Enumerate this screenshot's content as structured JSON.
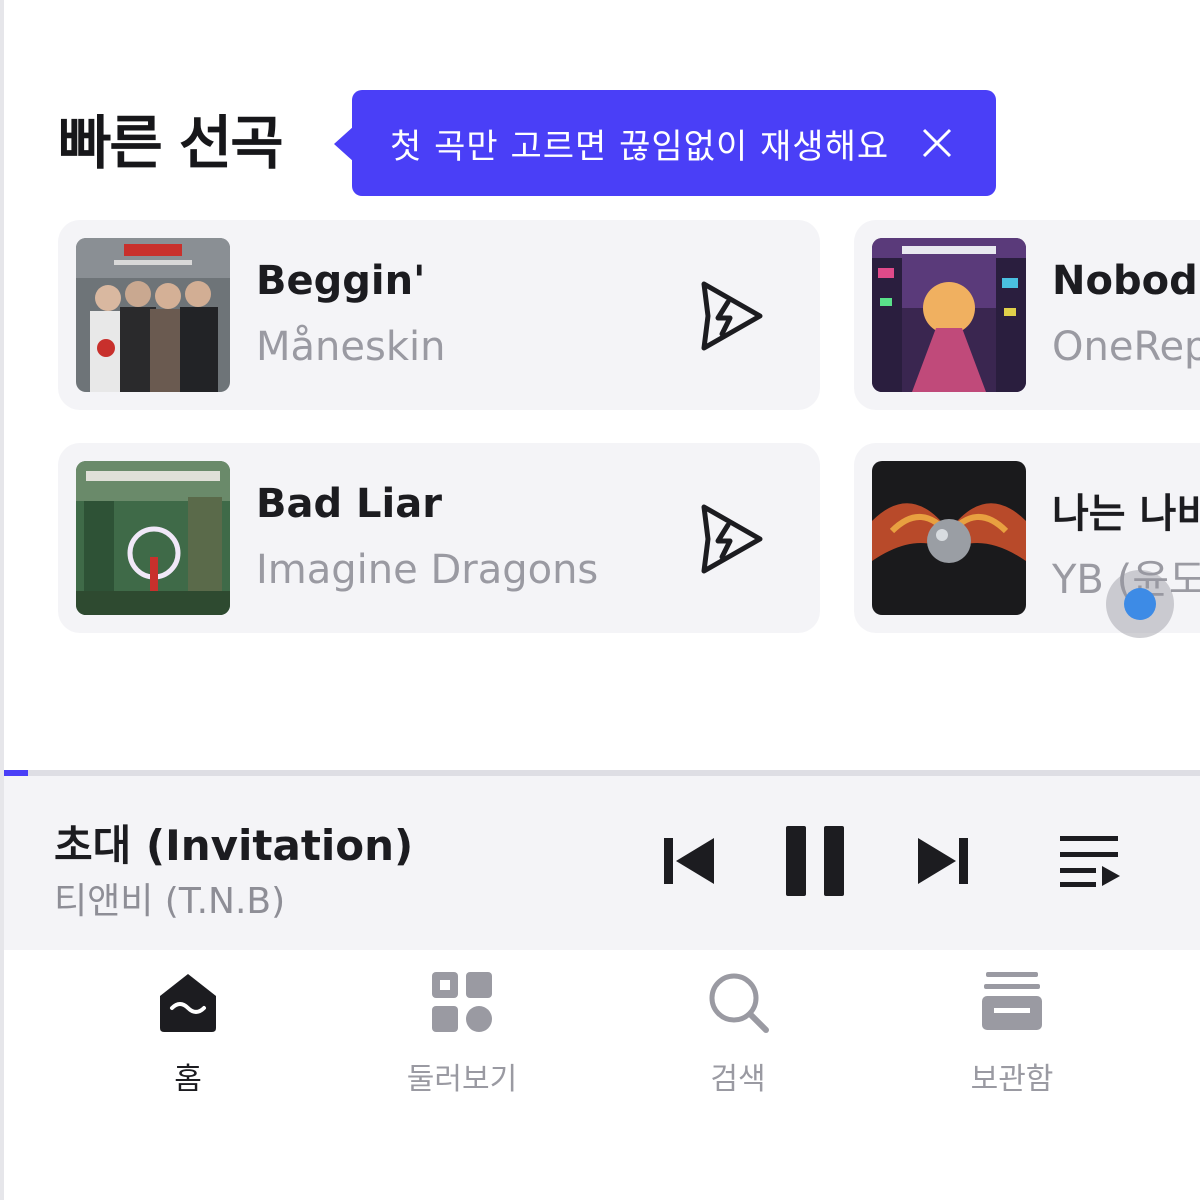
{
  "section": {
    "title": "빠른 선곡"
  },
  "tooltip": {
    "text": "첫 곡만 고르면 끊임없이 재생해요"
  },
  "cards": [
    {
      "title": "Beggin'",
      "artist": "Måneskin"
    },
    {
      "title": "Nobod",
      "artist": "OneRep"
    },
    {
      "title": "Bad Liar",
      "artist": "Imagine Dragons"
    },
    {
      "title": "나는 나비",
      "artist": "YB (윤도"
    }
  ],
  "now_playing": {
    "title": "초대 (Invitation)",
    "artist": "티앤비 (T.N.B)",
    "progress": 0.02
  },
  "tabs": [
    {
      "label": "홈",
      "icon": "home-icon",
      "active": true
    },
    {
      "label": "둘러보기",
      "icon": "browse-icon",
      "active": false
    },
    {
      "label": "검색",
      "icon": "search-icon",
      "active": false
    },
    {
      "label": "보관함",
      "icon": "library-icon",
      "active": false
    }
  ],
  "colors": {
    "accent": "#4a3ff7",
    "card_bg": "#f4f4f7",
    "muted_text": "#9a9aa2"
  }
}
